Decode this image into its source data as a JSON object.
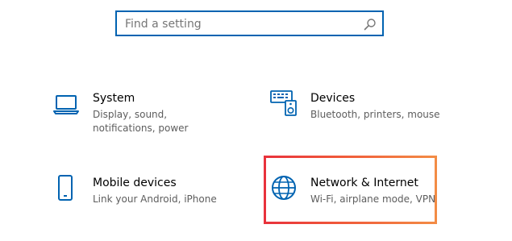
{
  "search": {
    "placeholder": "Find a setting",
    "icon": "search-icon"
  },
  "tiles": [
    {
      "title": "System",
      "desc": "Display, sound, notifications, power",
      "icon": "laptop-icon"
    },
    {
      "title": "Devices",
      "desc": "Bluetooth, printers, mouse",
      "icon": "keyboard-speaker-icon"
    },
    {
      "title": "Mobile devices",
      "desc": "Link your Android, iPhone",
      "icon": "phone-icon"
    },
    {
      "title": "Network & Internet",
      "desc": "Wi-Fi, airplane mode, VPN",
      "icon": "globe-icon"
    }
  ],
  "colors": {
    "accent": "#0063b1",
    "highlight_start": "#e8323c",
    "highlight_end": "#f38c45"
  }
}
